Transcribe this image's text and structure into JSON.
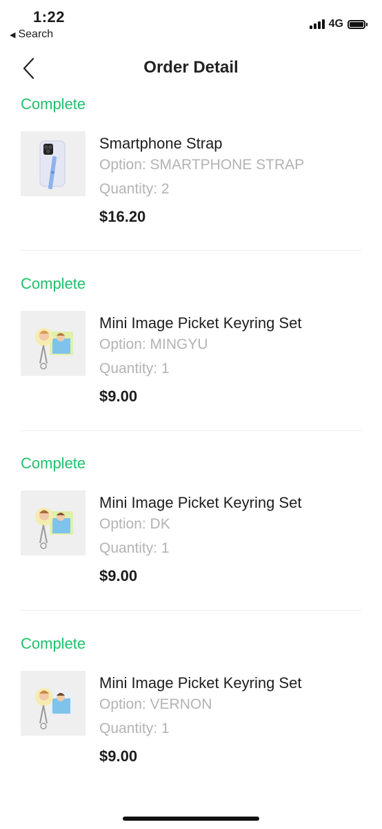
{
  "status_bar": {
    "time": "1:22",
    "back_label": "Search",
    "network": "4G"
  },
  "nav": {
    "title": "Order Detail"
  },
  "orders": [
    {
      "status": "Complete",
      "name": "Smartphone Strap",
      "option": "Option: SMARTPHONE STRAP",
      "quantity": "Quantity: 2",
      "price": "$16.20",
      "thumb": "smartphone-strap"
    },
    {
      "status": "Complete",
      "name": "Mini Image Picket Keyring Set",
      "option": "Option: MINGYU",
      "quantity": "Quantity: 1",
      "price": "$9.00",
      "thumb": "keyring-set"
    },
    {
      "status": "Complete",
      "name": "Mini Image Picket Keyring Set",
      "option": "Option: DK",
      "quantity": "Quantity: 1",
      "price": "$9.00",
      "thumb": "keyring-set"
    },
    {
      "status": "Complete",
      "name": "Mini Image Picket Keyring Set",
      "option": "Option: VERNON",
      "quantity": "Quantity: 1",
      "price": "$9.00",
      "thumb": "keyring-set"
    }
  ],
  "colors": {
    "status_green": "#1fc16b",
    "secondary_text": "#b3b3b3"
  }
}
